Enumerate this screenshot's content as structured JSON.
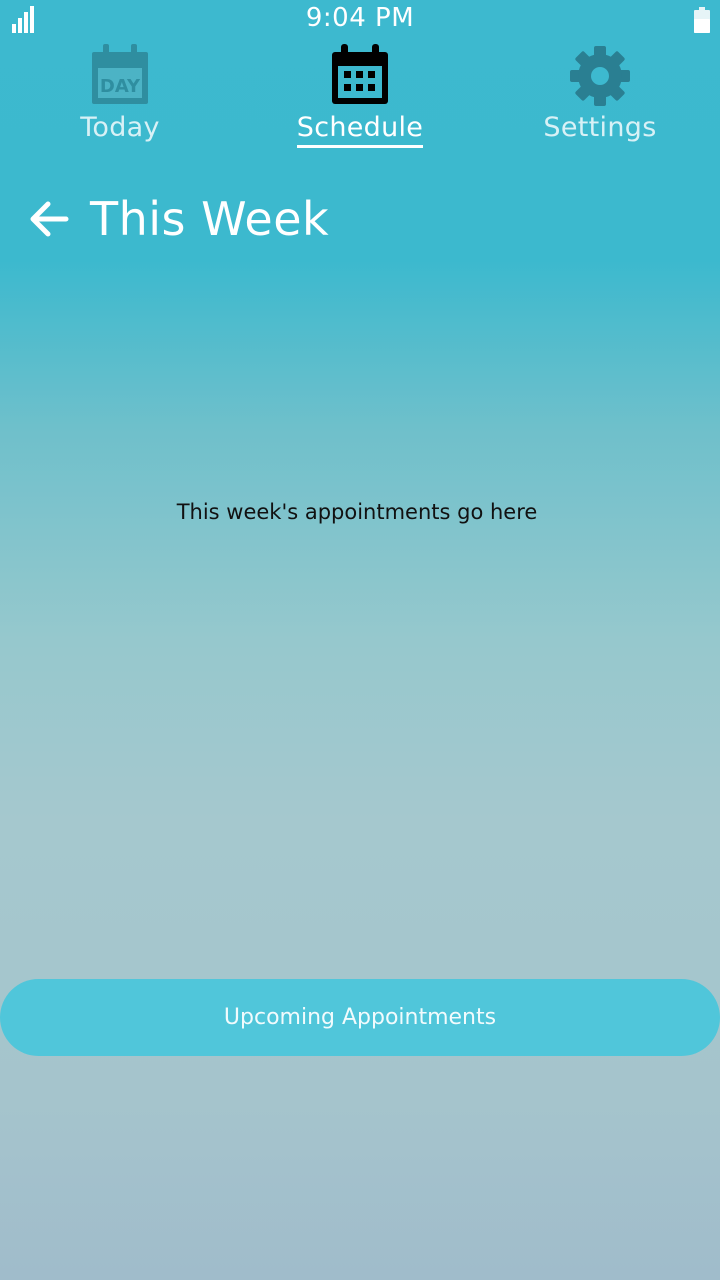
{
  "status_bar": {
    "time": "9:04 PM",
    "signal_icon": "signal-bars-icon",
    "battery_icon": "battery-icon"
  },
  "tabs": [
    {
      "label": "Today",
      "icon": "calendar-day-icon",
      "active": false
    },
    {
      "label": "Schedule",
      "icon": "calendar-week-icon",
      "active": true
    },
    {
      "label": "Settings",
      "icon": "gear-icon",
      "active": false
    }
  ],
  "header": {
    "back_icon": "arrow-left-icon",
    "title": "This Week"
  },
  "main": {
    "placeholder": "This week's appointments go here"
  },
  "actions": {
    "upcoming_label": "Upcoming Appointments"
  },
  "colors": {
    "accent": "#50c6da",
    "header_bg": "#3db9cf",
    "active_icon": "#000000",
    "inactive_icon": "#2a7f92"
  }
}
